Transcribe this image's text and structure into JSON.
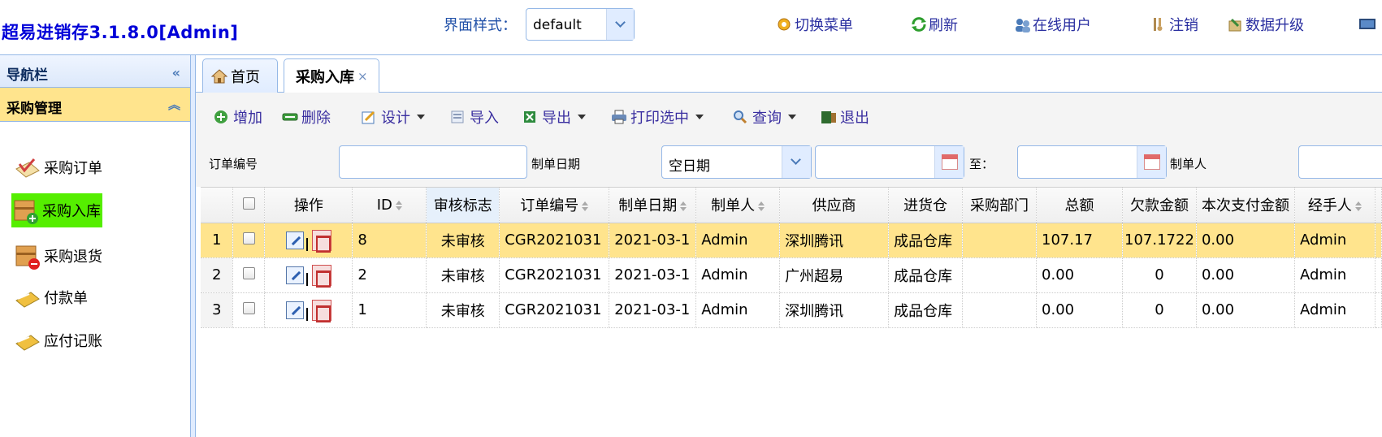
{
  "app": {
    "title": "超易进销存3.1.8.0[Admin]",
    "theme_label": "界面样式：",
    "theme_value": "default"
  },
  "header_buttons": [
    {
      "name": "switch-menu",
      "label": "切换菜单",
      "icon": "gear-icon"
    },
    {
      "name": "refresh",
      "label": "刷新",
      "icon": "refresh-icon"
    },
    {
      "name": "online-users",
      "label": "在线用户",
      "icon": "users-icon"
    },
    {
      "name": "logout",
      "label": "注销",
      "icon": "key-icon"
    },
    {
      "name": "data-upgrade",
      "label": "数据升级",
      "icon": "upgrade-icon"
    }
  ],
  "sidebar": {
    "title": "导航栏",
    "section": "采购管理",
    "items": [
      {
        "label": "采购订单",
        "icon": "purchase-order-icon"
      },
      {
        "label": "采购入库",
        "icon": "purchase-inbound-icon",
        "active": true
      },
      {
        "label": "采购退货",
        "icon": "purchase-return-icon"
      },
      {
        "label": "付款单",
        "icon": "payment-icon"
      },
      {
        "label": "应付记账",
        "icon": "payable-icon"
      }
    ]
  },
  "tabs": {
    "home": "首页",
    "current": "采购入库",
    "close": "×"
  },
  "toolbar": {
    "add": "增加",
    "delete": "删除",
    "design": "设计",
    "import": "导入",
    "export": "导出",
    "print": "打印选中",
    "query": "查询",
    "exit": "退出"
  },
  "search": {
    "order_no_label": "订单编号",
    "date_label": "制单日期",
    "date_mode": "空日期",
    "to_label": "至：",
    "creator_label": "制单人"
  },
  "grid": {
    "columns": [
      "操作",
      "ID",
      "审核标志",
      "订单编号",
      "制单日期",
      "制单人",
      "供应商",
      "进货仓",
      "采购部门",
      "总额",
      "欠款金额",
      "本次支付金额",
      "经手人"
    ],
    "rows": [
      {
        "n": "1",
        "id": "8",
        "status": "未审核",
        "order": "CGR2021031",
        "date": "2021-03-1",
        "creator": "Admin",
        "supplier": "深圳腾讯",
        "warehouse": "成品仓库",
        "dept": "",
        "total": "107.17",
        "owed": "107.1722",
        "paid": "0.00",
        "handler": "Admin",
        "selected": true
      },
      {
        "n": "2",
        "id": "2",
        "status": "未审核",
        "order": "CGR2021031",
        "date": "2021-03-1",
        "creator": "Admin",
        "supplier": "广州超易",
        "warehouse": "成品仓库",
        "dept": "",
        "total": "0.00",
        "owed": "0",
        "paid": "0.00",
        "handler": "Admin",
        "selected": false
      },
      {
        "n": "3",
        "id": "1",
        "status": "未审核",
        "order": "CGR2021031",
        "date": "2021-03-1",
        "creator": "Admin",
        "supplier": "深圳腾讯",
        "warehouse": "成品仓库",
        "dept": "",
        "total": "0.00",
        "owed": "0",
        "paid": "0.00",
        "handler": "Admin",
        "selected": false
      }
    ]
  }
}
